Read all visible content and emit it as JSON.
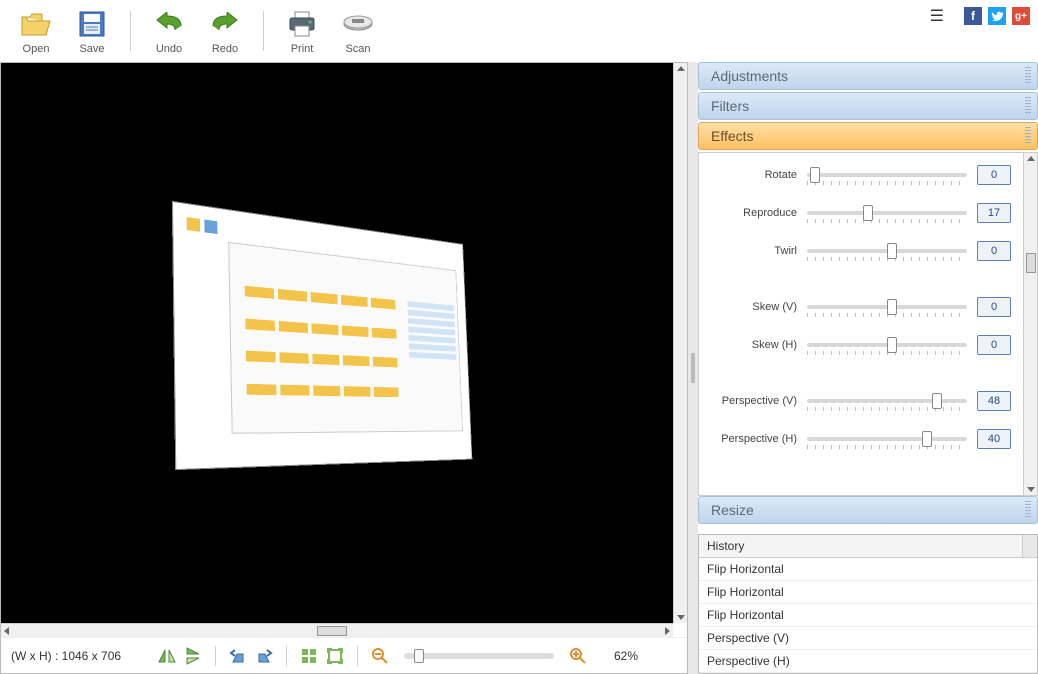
{
  "toolbar": {
    "open": "Open",
    "save": "Save",
    "undo": "Undo",
    "redo": "Redo",
    "print": "Print",
    "scan": "Scan"
  },
  "accordion": {
    "adjustments": "Adjustments",
    "filters": "Filters",
    "effects": "Effects",
    "resize": "Resize"
  },
  "effects": {
    "rotate": {
      "label": "Rotate",
      "value": "0",
      "pos": 2
    },
    "reproduce": {
      "label": "Reproduce",
      "value": "17",
      "pos": 35
    },
    "twirl": {
      "label": "Twirl",
      "value": "0",
      "pos": 50
    },
    "skew_v": {
      "label": "Skew (V)",
      "value": "0",
      "pos": 50
    },
    "skew_h": {
      "label": "Skew (H)",
      "value": "0",
      "pos": 50
    },
    "perspective_v": {
      "label": "Perspective (V)",
      "value": "48",
      "pos": 78
    },
    "perspective_h": {
      "label": "Perspective (H)",
      "value": "40",
      "pos": 72
    }
  },
  "history": {
    "header": "History",
    "items": [
      "Flip Horizontal",
      "Flip Horizontal",
      "Flip Horizontal",
      "Perspective (V)",
      "Perspective (H)"
    ]
  },
  "status": {
    "dimensions": "(W x H) : 1046 x 706",
    "zoom": "62%"
  }
}
